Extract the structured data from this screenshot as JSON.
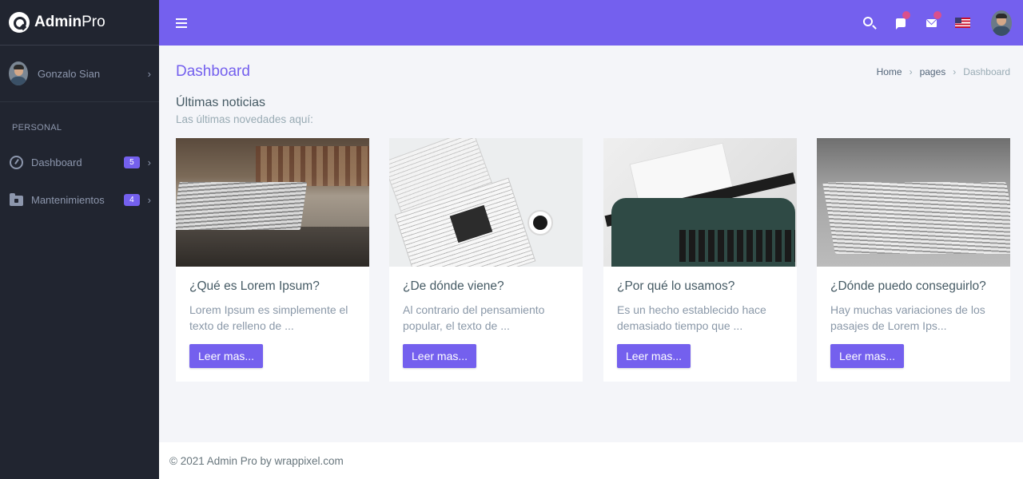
{
  "app": {
    "logo_bold": "Admin",
    "logo_light": "Pro"
  },
  "sidebar": {
    "user_name": "Gonzalo Sian",
    "section_label": "PERSONAL",
    "items": [
      {
        "label": "Dashboard",
        "badge": "5",
        "icon": "gauge-icon"
      },
      {
        "label": "Mantenimientos",
        "badge": "4",
        "icon": "folder-icon"
      }
    ]
  },
  "topbar": {
    "icons": [
      "menu-icon",
      "search-icon",
      "flag-icon",
      "mail-icon",
      "us-flag-icon",
      "user-avatar"
    ]
  },
  "page": {
    "title": "Dashboard",
    "breadcrumb": [
      "Home",
      "pages",
      "Dashboard"
    ]
  },
  "news": {
    "title": "Últimas noticias",
    "subtitle": "Las últimas novedades aquí:",
    "cards": [
      {
        "title": "¿Qué es Lorem Ipsum?",
        "text": "Lorem Ipsum es simplemente el texto de relleno de ...",
        "button": "Leer mas..."
      },
      {
        "title": "¿De dónde viene?",
        "text": "Al contrario del pensamiento popular, el texto de ...",
        "button": "Leer mas..."
      },
      {
        "title": "¿Por qué lo usamos?",
        "text": "Es un hecho establecido hace demasiado tiempo que ...",
        "button": "Leer mas..."
      },
      {
        "title": "¿Dónde puedo conseguirlo?",
        "text": "Hay muchas variaciones de los pasajes de Lorem Ips...",
        "button": "Leer mas..."
      }
    ]
  },
  "footer": {
    "text": "© 2021 Admin Pro by wrappixel.com"
  },
  "colors": {
    "primary": "#7460ee",
    "sidebar": "#212530",
    "background": "#f4f5f9"
  }
}
